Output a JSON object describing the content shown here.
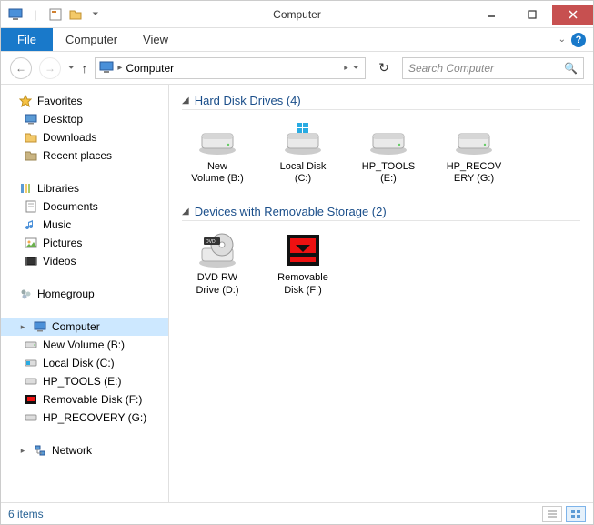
{
  "window": {
    "title": "Computer"
  },
  "ribbon": {
    "file": "File",
    "tabs": [
      "Computer",
      "View"
    ]
  },
  "nav": {
    "address": "Computer",
    "search_placeholder": "Search Computer"
  },
  "tree": {
    "favorites": {
      "label": "Favorites",
      "items": [
        "Desktop",
        "Downloads",
        "Recent places"
      ]
    },
    "libraries": {
      "label": "Libraries",
      "items": [
        "Documents",
        "Music",
        "Pictures",
        "Videos"
      ]
    },
    "homegroup": {
      "label": "Homegroup"
    },
    "computer": {
      "label": "Computer",
      "items": [
        "New Volume (B:)",
        "Local Disk (C:)",
        "HP_TOOLS (E:)",
        "Removable Disk (F:)",
        "HP_RECOVERY (G:)"
      ]
    },
    "network": {
      "label": "Network"
    }
  },
  "groups": [
    {
      "title": "Hard Disk Drives (4)",
      "items": [
        {
          "line1": "New",
          "line2": "Volume (B:)",
          "icon": "hdd"
        },
        {
          "line1": "Local Disk",
          "line2": "(C:)",
          "icon": "hdd-win"
        },
        {
          "line1": "HP_TOOLS",
          "line2": "(E:)",
          "icon": "hdd"
        },
        {
          "line1": "HP_RECOV",
          "line2": "ERY (G:)",
          "icon": "hdd"
        }
      ]
    },
    {
      "title": "Devices with Removable Storage (2)",
      "items": [
        {
          "line1": "DVD RW",
          "line2": "Drive (D:)",
          "icon": "dvd"
        },
        {
          "line1": "Removable",
          "line2": "Disk (F:)",
          "icon": "removable"
        }
      ]
    }
  ],
  "status": {
    "text": "6 items"
  }
}
